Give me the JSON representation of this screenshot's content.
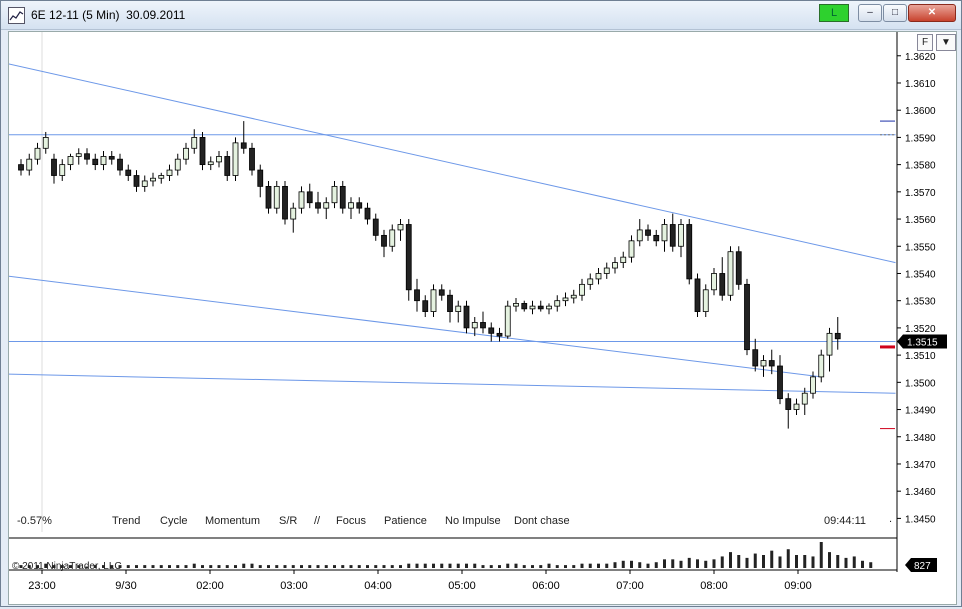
{
  "window": {
    "title": "6E 12-11 (5 Min)  30.09.2011",
    "connection_label": "L",
    "minimize_label": "–",
    "maximize_label": "□",
    "close_label": "✕"
  },
  "panel_buttons": {
    "format_label": "F",
    "dropdown_label": "▼"
  },
  "price_axis": {
    "ticks": [
      "1.3620",
      "1.3610",
      "1.3600",
      "1.3590",
      "1.3580",
      "1.3570",
      "1.3560",
      "1.3550",
      "1.3540",
      "1.3530",
      "1.3520",
      "1.3510",
      "1.3500",
      "1.3490",
      "1.3480",
      "1.3470",
      "1.3460",
      "1.3450"
    ],
    "last_price": "1.3515"
  },
  "time_axis": [
    "23:00",
    "9/30",
    "02:00",
    "03:00",
    "04:00",
    "05:00",
    "06:00",
    "07:00",
    "08:00",
    "09:00"
  ],
  "indicators": {
    "change": "-0.57%",
    "labels": [
      "Trend",
      "Cycle",
      "Momentum",
      "S/R",
      "//",
      "Focus",
      "Patience",
      "No Impulse",
      "Dont chase"
    ],
    "clock": "09:44:11",
    "dot": "."
  },
  "copyright": "© 2011 NinjaTrader, LLC",
  "volume_label": "827",
  "colors": {
    "line": "#6d98e8",
    "up": "#e5f2e0",
    "down": "#222222",
    "price_red": "#d0021b",
    "price_blue": "#1b2fa8"
  },
  "chart_data": {
    "type": "candlestick",
    "ylim": [
      1.3445,
      1.3628
    ],
    "candles": [
      [
        1.358,
        1.3582,
        1.3576,
        1.3578
      ],
      [
        1.3578,
        1.3584,
        1.3576,
        1.3582
      ],
      [
        1.3582,
        1.3588,
        1.358,
        1.3586
      ],
      [
        1.3586,
        1.3592,
        1.3584,
        1.359
      ],
      [
        1.3582,
        1.3584,
        1.3573,
        1.3576
      ],
      [
        1.3576,
        1.3582,
        1.3574,
        1.358
      ],
      [
        1.358,
        1.3584,
        1.3578,
        1.3583
      ],
      [
        1.3583,
        1.3586,
        1.358,
        1.3584
      ],
      [
        1.3584,
        1.3586,
        1.358,
        1.3582
      ],
      [
        1.3582,
        1.3584,
        1.3578,
        1.358
      ],
      [
        1.358,
        1.3585,
        1.3578,
        1.3583
      ],
      [
        1.3583,
        1.3585,
        1.358,
        1.3582
      ],
      [
        1.3582,
        1.3584,
        1.3576,
        1.3578
      ],
      [
        1.3578,
        1.358,
        1.3574,
        1.3576
      ],
      [
        1.3576,
        1.3578,
        1.357,
        1.3572
      ],
      [
        1.3572,
        1.3576,
        1.357,
        1.3574
      ],
      [
        1.3574,
        1.3577,
        1.3572,
        1.3575
      ],
      [
        1.3575,
        1.3577,
        1.3573,
        1.3576
      ],
      [
        1.3576,
        1.358,
        1.3574,
        1.3578
      ],
      [
        1.3578,
        1.3584,
        1.3576,
        1.3582
      ],
      [
        1.3582,
        1.3588,
        1.358,
        1.3586
      ],
      [
        1.3586,
        1.3593,
        1.3584,
        1.359
      ],
      [
        1.359,
        1.3592,
        1.3578,
        1.358
      ],
      [
        1.358,
        1.3583,
        1.3578,
        1.3581
      ],
      [
        1.3581,
        1.3585,
        1.3579,
        1.3583
      ],
      [
        1.3583,
        1.3585,
        1.3574,
        1.3576
      ],
      [
        1.3576,
        1.359,
        1.3574,
        1.3588
      ],
      [
        1.3588,
        1.3596,
        1.3584,
        1.3586
      ],
      [
        1.3586,
        1.3588,
        1.3576,
        1.3578
      ],
      [
        1.3578,
        1.358,
        1.3568,
        1.3572
      ],
      [
        1.3572,
        1.3574,
        1.3562,
        1.3564
      ],
      [
        1.3564,
        1.3574,
        1.3562,
        1.3572
      ],
      [
        1.3572,
        1.3574,
        1.3558,
        1.356
      ],
      [
        1.356,
        1.3566,
        1.3555,
        1.3564
      ],
      [
        1.3564,
        1.3572,
        1.3562,
        1.357
      ],
      [
        1.357,
        1.3573,
        1.3564,
        1.3566
      ],
      [
        1.3566,
        1.357,
        1.3562,
        1.3564
      ],
      [
        1.3564,
        1.3568,
        1.356,
        1.3566
      ],
      [
        1.3566,
        1.3574,
        1.3564,
        1.3572
      ],
      [
        1.3572,
        1.3574,
        1.3562,
        1.3564
      ],
      [
        1.3564,
        1.3568,
        1.356,
        1.3566
      ],
      [
        1.3566,
        1.3568,
        1.3562,
        1.3564
      ],
      [
        1.3564,
        1.3566,
        1.3558,
        1.356
      ],
      [
        1.356,
        1.3562,
        1.3552,
        1.3554
      ],
      [
        1.3554,
        1.3556,
        1.3546,
        1.355
      ],
      [
        1.355,
        1.3558,
        1.3548,
        1.3556
      ],
      [
        1.3556,
        1.356,
        1.3552,
        1.3558
      ],
      [
        1.3558,
        1.356,
        1.353,
        1.3534
      ],
      [
        1.3534,
        1.3538,
        1.3526,
        1.353
      ],
      [
        1.353,
        1.3532,
        1.3524,
        1.3526
      ],
      [
        1.3526,
        1.3536,
        1.3524,
        1.3534
      ],
      [
        1.3534,
        1.3536,
        1.353,
        1.3532
      ],
      [
        1.3532,
        1.3534,
        1.3522,
        1.3526
      ],
      [
        1.3526,
        1.353,
        1.3522,
        1.3528
      ],
      [
        1.3528,
        1.353,
        1.3518,
        1.352
      ],
      [
        1.352,
        1.3524,
        1.3517,
        1.3522
      ],
      [
        1.3522,
        1.3526,
        1.3518,
        1.352
      ],
      [
        1.352,
        1.3522,
        1.3515,
        1.3518
      ],
      [
        1.3518,
        1.352,
        1.3515,
        1.3517
      ],
      [
        1.3517,
        1.353,
        1.3516,
        1.3528
      ],
      [
        1.3528,
        1.3531,
        1.3526,
        1.3529
      ],
      [
        1.3529,
        1.353,
        1.3526,
        1.3527
      ],
      [
        1.3527,
        1.353,
        1.3525,
        1.3528
      ],
      [
        1.3528,
        1.353,
        1.3526,
        1.3527
      ],
      [
        1.3527,
        1.3529,
        1.3525,
        1.3528
      ],
      [
        1.3528,
        1.3532,
        1.3526,
        1.353
      ],
      [
        1.353,
        1.3533,
        1.3528,
        1.3531
      ],
      [
        1.3531,
        1.3534,
        1.3529,
        1.3532
      ],
      [
        1.3532,
        1.3538,
        1.353,
        1.3536
      ],
      [
        1.3536,
        1.354,
        1.3534,
        1.3538
      ],
      [
        1.3538,
        1.3542,
        1.3536,
        1.354
      ],
      [
        1.354,
        1.3544,
        1.3538,
        1.3542
      ],
      [
        1.3542,
        1.3546,
        1.354,
        1.3544
      ],
      [
        1.3544,
        1.3548,
        1.3542,
        1.3546
      ],
      [
        1.3546,
        1.3554,
        1.3544,
        1.3552
      ],
      [
        1.3552,
        1.356,
        1.355,
        1.3556
      ],
      [
        1.3556,
        1.3558,
        1.3552,
        1.3554
      ],
      [
        1.3554,
        1.3556,
        1.355,
        1.3552
      ],
      [
        1.3552,
        1.356,
        1.3548,
        1.3558
      ],
      [
        1.3558,
        1.3562,
        1.3548,
        1.355
      ],
      [
        1.355,
        1.356,
        1.3546,
        1.3558
      ],
      [
        1.3558,
        1.356,
        1.3536,
        1.3538
      ],
      [
        1.3538,
        1.354,
        1.3524,
        1.3526
      ],
      [
        1.3526,
        1.3536,
        1.3524,
        1.3534
      ],
      [
        1.3534,
        1.3542,
        1.3532,
        1.354
      ],
      [
        1.354,
        1.3546,
        1.353,
        1.3532
      ],
      [
        1.3532,
        1.355,
        1.353,
        1.3548
      ],
      [
        1.3548,
        1.355,
        1.3534,
        1.3536
      ],
      [
        1.3536,
        1.3538,
        1.351,
        1.3512
      ],
      [
        1.3512,
        1.3516,
        1.3504,
        1.3506
      ],
      [
        1.3506,
        1.351,
        1.3502,
        1.3508
      ],
      [
        1.3508,
        1.3512,
        1.3503,
        1.3506
      ],
      [
        1.3506,
        1.351,
        1.3492,
        1.3494
      ],
      [
        1.3494,
        1.3496,
        1.3483,
        1.349
      ],
      [
        1.349,
        1.3494,
        1.3488,
        1.3492
      ],
      [
        1.3492,
        1.3498,
        1.3488,
        1.3496
      ],
      [
        1.3496,
        1.3504,
        1.3494,
        1.3502
      ],
      [
        1.3502,
        1.3512,
        1.35,
        1.351
      ],
      [
        1.351,
        1.352,
        1.3504,
        1.3518
      ],
      [
        1.3518,
        1.3524,
        1.3512,
        1.3516
      ]
    ],
    "volume": [
      2,
      2,
      2,
      3,
      2,
      2,
      2,
      2,
      1,
      2,
      2,
      2,
      2,
      2,
      2,
      2,
      2,
      2,
      2,
      2,
      2,
      3,
      2,
      2,
      2,
      2,
      2,
      3,
      3,
      2,
      2,
      2,
      2,
      2,
      2,
      2,
      2,
      2,
      2,
      2,
      2,
      2,
      2,
      2,
      2,
      2,
      2,
      3,
      3,
      3,
      3,
      3,
      3,
      3,
      3,
      3,
      2,
      2,
      2,
      3,
      3,
      2,
      2,
      2,
      3,
      2,
      2,
      2,
      3,
      3,
      3,
      3,
      4,
      5,
      5,
      4,
      3,
      4,
      6,
      6,
      5,
      7,
      6,
      5,
      6,
      8,
      11,
      9,
      7,
      10,
      9,
      12,
      8,
      13,
      9,
      9,
      8,
      18,
      11,
      9,
      7,
      8,
      5,
      4
    ],
    "lines": [
      {
        "name": "upper-trend",
        "p1": [
          0,
          1.3617
        ],
        "p2": [
          106,
          1.3544
        ]
      },
      {
        "name": "lower-trend",
        "p1": [
          0,
          1.3539
        ],
        "p2": [
          97,
          1.3502
        ]
      },
      {
        "name": "horizontal-1",
        "p1": [
          0,
          1.3591
        ],
        "p2": [
          106,
          1.3591
        ]
      },
      {
        "name": "horizontal-2",
        "p1": [
          0,
          1.3515
        ],
        "p2": [
          106,
          1.3515
        ]
      },
      {
        "name": "flat-trend",
        "p1": [
          0,
          1.3503
        ],
        "p2": [
          106,
          1.3496
        ]
      }
    ],
    "markers": [
      {
        "price": 1.3596,
        "color": "price_blue"
      },
      {
        "price": 1.3591,
        "color": "gray"
      },
      {
        "price": 1.3513,
        "color": "price_red"
      },
      {
        "price": 1.3483,
        "color": "price_red"
      }
    ]
  }
}
